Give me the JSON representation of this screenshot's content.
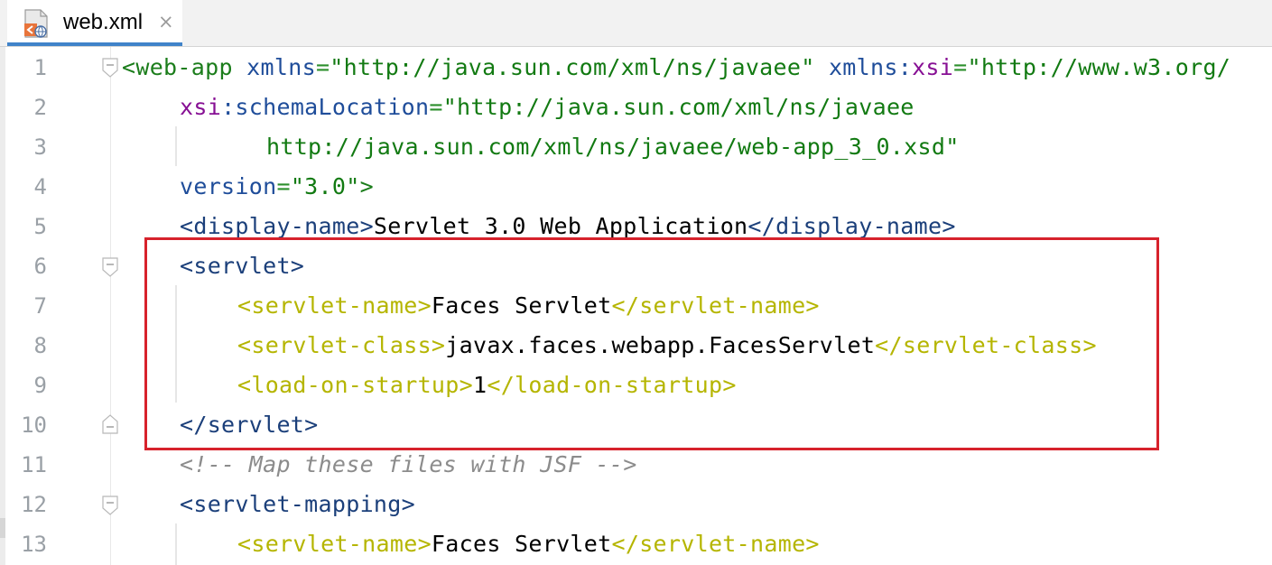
{
  "tab": {
    "label": "web.xml",
    "close_glyph": "×",
    "icon": "xml-file-icon"
  },
  "lines": {
    "n1": "1",
    "n2": "2",
    "n3": "3",
    "n4": "4",
    "n5": "5",
    "n6": "6",
    "n7": "7",
    "n8": "8",
    "n9": "9",
    "n10": "10",
    "n11": "11",
    "n12": "12",
    "n13": "13"
  },
  "code": {
    "l1": {
      "open": "<web-app",
      "attr1": "xmlns",
      "eq1": "=",
      "val1": "\"http://java.sun.com/xml/ns/javaee\"",
      "attr2a": "xmlns:",
      "attr2b": "xsi",
      "eq2": "=",
      "val2": "\"http://www.w3.org/"
    },
    "l2": {
      "attr_ns": "xsi",
      "attr": ":schemaLocation",
      "eq": "=",
      "val": "\"http://java.sun.com/xml/ns/javaee"
    },
    "l3": {
      "val": "http://java.sun.com/xml/ns/javaee/web-app_3_0.xsd\""
    },
    "l4": {
      "attr": "version",
      "eq": "=",
      "val": "\"3.0\"",
      "close": ">"
    },
    "l5": {
      "open": "<display-name>",
      "text": "Servlet 3.0 Web Application",
      "close": "</display-name>"
    },
    "l6": {
      "open": "<servlet>"
    },
    "l7": {
      "open": "<servlet-name>",
      "text": "Faces Servlet",
      "close": "</servlet-name>"
    },
    "l8": {
      "open": "<servlet-class>",
      "text": "javax.faces.webapp.FacesServlet",
      "close": "</servlet-class>"
    },
    "l9": {
      "open": "<load-on-startup>",
      "text": "1",
      "close": "</load-on-startup>"
    },
    "l10": {
      "close": "</servlet>"
    },
    "l11": {
      "comment": "<!-- Map these files with JSF -->"
    },
    "l12": {
      "open": "<servlet-mapping>"
    },
    "l13": {
      "open": "<servlet-name>",
      "text": "Faces Servlet",
      "close": "</servlet-name>"
    }
  },
  "colors": {
    "highlight_box": "#d7222c",
    "tab_underline": "#4083c9",
    "xml_tag": "#1f4d9a",
    "xml_attribute_value": "#127a12",
    "xml_nested_tag": "#b5b500",
    "comment": "#8c8c8c"
  }
}
